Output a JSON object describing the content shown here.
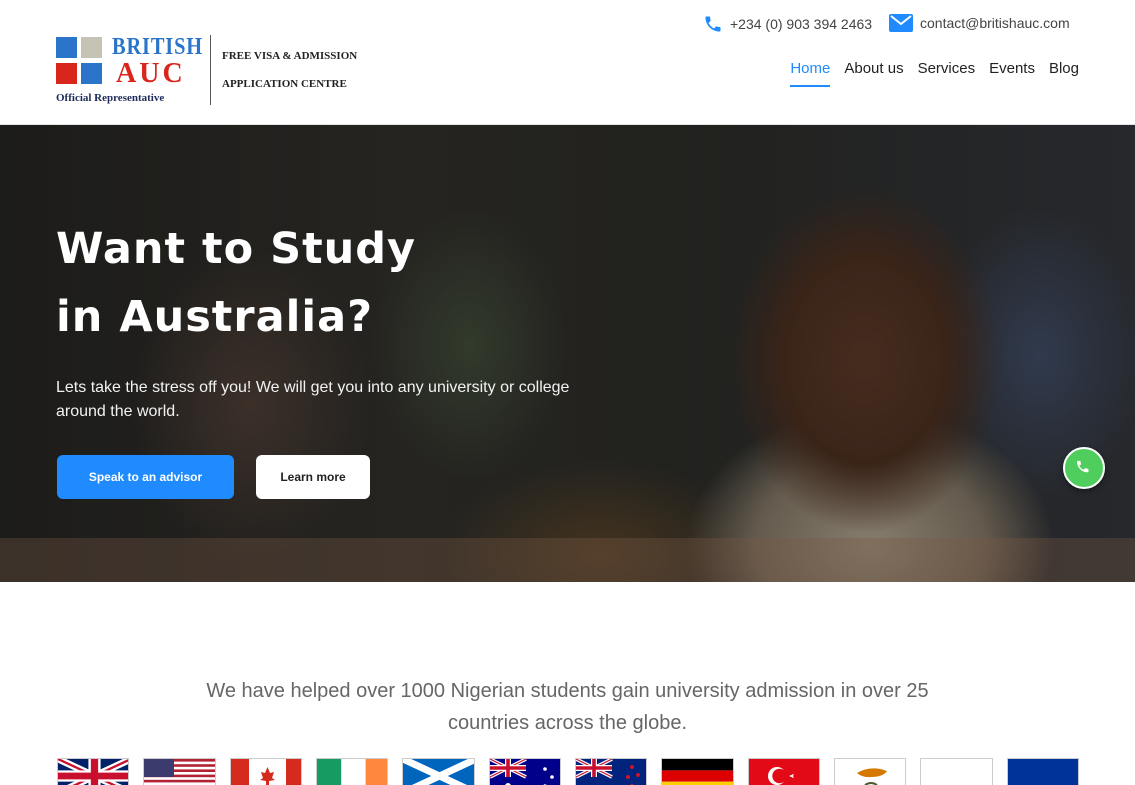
{
  "header": {
    "brand_word1": "BRITISH",
    "brand_word2": "AUC",
    "brand_official": "Official Representative",
    "tagline_line1": "FREE VISA & ADMISSION",
    "tagline_line2": "APPLICATION CENTRE",
    "phone": "+234 (0) 903 394 2463",
    "email": "contact@britishauc.com",
    "nav": [
      {
        "label": "Home",
        "active": true
      },
      {
        "label": "About us",
        "active": false
      },
      {
        "label": "Services",
        "active": false
      },
      {
        "label": "Events",
        "active": false
      },
      {
        "label": "Blog",
        "active": false
      }
    ]
  },
  "hero": {
    "title_line1": "Want to Study",
    "title_line2": "in Australia?",
    "subtitle": "Lets take the stress off you! We will get you into any university or college around the world.",
    "primary_button": "Speak to an advisor",
    "secondary_button": "Learn more"
  },
  "stats": {
    "line1": "We have helped over 1000 Nigerian students gain university admission in over 25",
    "line2": "countries across the globe."
  },
  "flags": [
    "united-kingdom",
    "united-states",
    "canada",
    "ireland",
    "scotland",
    "australia",
    "new-zealand",
    "germany",
    "turkey",
    "cyprus",
    "blank",
    "european-union"
  ],
  "colors": {
    "accent": "#1f8bff",
    "brand_blue": "#2a74c9",
    "brand_red": "#d9261c",
    "whatsapp": "#4fce5d"
  }
}
